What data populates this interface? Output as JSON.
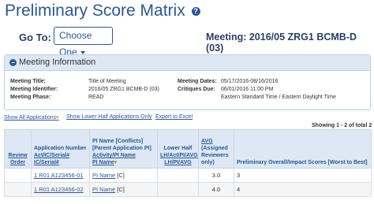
{
  "page": {
    "title": "Preliminary Score Matrix",
    "help_icon": "?"
  },
  "goto": {
    "label": "Go To:",
    "dropdown": "Choose One"
  },
  "meeting_heading": "Meeting: 2016/05 ZRG1 BCMB-D (03)",
  "meeting_info": {
    "header": "Meeting Information",
    "collapse_icon": "−",
    "left": [
      {
        "label": "Meeting Title:",
        "value": "Title of Meeting"
      },
      {
        "label": "Meeting Identifier:",
        "value": "2016/05 ZRG1 BCMB-D (03)"
      },
      {
        "label": "Meeting Phase:",
        "value": "READ"
      }
    ],
    "right": [
      {
        "label": "Meeting Dates:",
        "value": "05/17/2016-08/16/2016"
      },
      {
        "label": "Critiques Due:",
        "value": "06/01/2016 11:00 PM"
      },
      {
        "label": "",
        "value": "Eastern Standard Time / Eastern Daylight Time"
      }
    ]
  },
  "links": {
    "show_all": "Show All Applications",
    "show_lower_half": "Show Lower Half Applications Only",
    "export": "Export to Excel"
  },
  "showing": "Showing 1 - 2 of total 2",
  "table": {
    "headers": {
      "review_order": "Review Order",
      "app_number_l1": "Application Number",
      "app_number_l2": "Act/IC/Serial#",
      "app_number_l3": "IC/Serial#",
      "pi_l1": "PI Name [Conflicts]",
      "pi_l2": "[Parent Application PI]",
      "pi_l3": "Activity/PI Name",
      "pi_l4": "PI Name",
      "lower_half_l1": "Lower Half",
      "lower_half_l2": "LH/Act/PI/AVG",
      "lower_half_l3": "LH/PI/AVG",
      "avg_l1": "AVG",
      "avg_l2": "(Assigned",
      "avg_l3": "Reviewers",
      "avg_l4": "only)",
      "scores": "Preliminary Overall/Impact Scores [Worst to Best]"
    },
    "rows": [
      {
        "review_order": "",
        "app_number": "1 R01 A123456-01",
        "pi": "PI Name",
        "conflict": "[C]",
        "lower_half": "",
        "avg": "3.0",
        "score": "3"
      },
      {
        "review_order": "",
        "app_number": "1 R01 A123456-02",
        "pi": "PI Name",
        "conflict": "[C]",
        "lower_half": "",
        "avg": "4.0",
        "score": "4"
      }
    ]
  },
  "colors": {
    "brand_blue": "#2b5797",
    "header_bg": "#dde8f4",
    "accent_orange": "#e88c1c"
  }
}
